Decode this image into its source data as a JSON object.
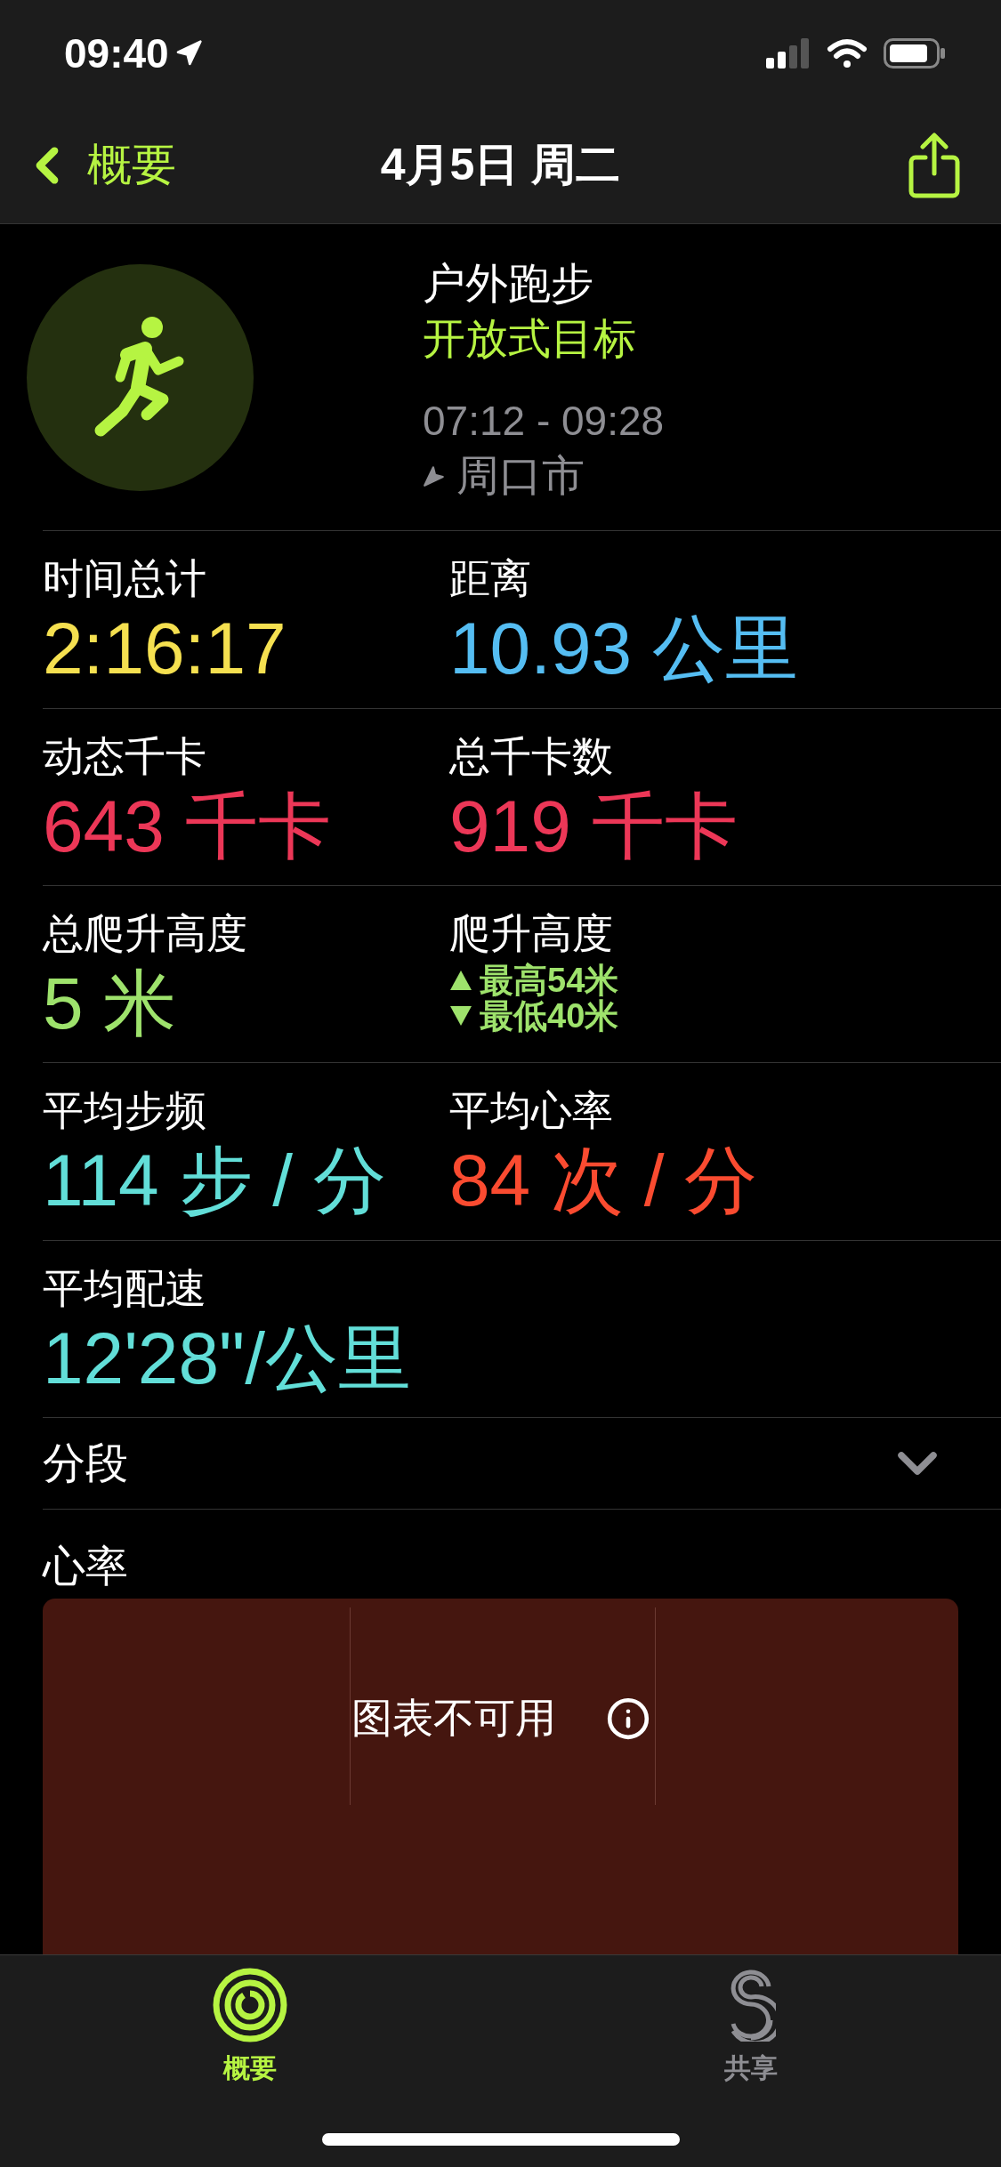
{
  "status_bar": {
    "time": "09:40"
  },
  "nav": {
    "back": "概要",
    "title": "4月5日 周二"
  },
  "workout": {
    "name": "户外跑步",
    "goal": "开放式目标",
    "time_range": "07:12 - 09:28",
    "location": "周口市"
  },
  "stats": [
    [
      {
        "kind": "value",
        "label": "时间总计",
        "value": "2:16:17",
        "color": "#f5e050"
      },
      {
        "kind": "value",
        "label": "距离",
        "value": "10.93 公里",
        "color": "#55bdf2"
      }
    ],
    [
      {
        "kind": "value",
        "label": "动态千卡",
        "value": "643 千卡",
        "color": "#ec3757"
      },
      {
        "kind": "value",
        "label": "总千卡数",
        "value": "919 千卡",
        "color": "#ec3757"
      }
    ],
    [
      {
        "kind": "value",
        "label": "总爬升高度",
        "value": "5 米",
        "color": "#9ee26c"
      },
      {
        "kind": "range",
        "label": "爬升高度",
        "high": "最高54米",
        "low": "最低40米",
        "color": "#9ee26c"
      }
    ],
    [
      {
        "kind": "value",
        "label": "平均步频",
        "value": "114 步 / 分",
        "color": "#62ded8"
      },
      {
        "kind": "value",
        "label": "平均心率",
        "value": "84 次 / 分",
        "color": "#fa4b30"
      }
    ],
    [
      {
        "kind": "value",
        "label": "平均配速",
        "value": "12'28\"/公里",
        "color": "#62ded8"
      }
    ]
  ],
  "splits": {
    "label": "分段",
    "expanded": false
  },
  "heart_rate": {
    "title": "心率",
    "message": "图表不可用"
  },
  "tab_bar": [
    {
      "kind": "rings",
      "label": "概要",
      "selected": true
    },
    {
      "kind": "sharing",
      "label": "共享",
      "selected": false
    }
  ]
}
